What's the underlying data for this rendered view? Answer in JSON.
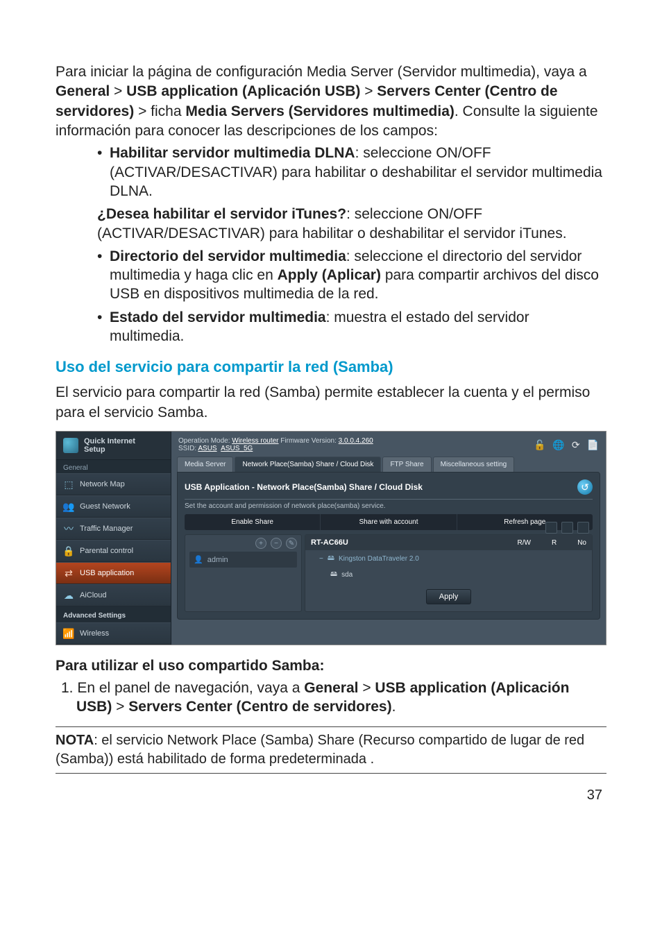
{
  "intro_pre": "Para iniciar la página de configuración Media Server (Servidor multimedia), vaya a ",
  "intro_b1": "General",
  "intro_gt1": " > ",
  "intro_b2": "USB application (Aplicación USB)",
  "intro_gt2": " > ",
  "intro_b3": "Servers Center (Centro de servidores)",
  "intro_gt3": " > ficha ",
  "intro_b4": "Media Servers (Servidores multimedia)",
  "intro_post": ". Consulte la siguiente información para conocer las descripciones de los campos:",
  "bul1_b": "Habilitar servidor multimedia DLNA",
  "bul1_t": ": seleccione ON/OFF (ACTIVAR/DESACTIVAR) para habilitar o deshabilitar el servidor multimedia DLNA.",
  "bul2_b": "¿Desea habilitar el servidor iTunes?",
  "bul2_t": ": seleccione ON/OFF (ACTIVAR/DESACTIVAR) para habilitar o deshabilitar el servidor iTunes.",
  "bul3_b": "Directorio del servidor multimedia",
  "bul3_t1": ": seleccione el directorio del servidor multimedia y haga clic en ",
  "bul3_apply": "Apply (Aplicar)",
  "bul3_t2": " para compartir archivos del disco USB en dispositivos multimedia de la red.",
  "bul4_b": "Estado del servidor multimedia",
  "bul4_t": ": muestra el estado del servidor multimedia.",
  "blue_heading": "Uso del servicio para compartir la red (Samba)",
  "samba_para": "El servicio para compartir la red (Samba) permite establecer la cuenta y el permiso para el servicio Samba.",
  "subhead": "Para utilizar el uso compartido Samba:",
  "num1_pre": "1.  En el panel de navegación, vaya a ",
  "num1_b1": "General",
  "num1_gt1": " > ",
  "num1_b2": "USB application (Aplicación USB)",
  "num1_gt2": " > ",
  "num1_b3": " Servers Center (Centro de servidores)",
  "num1_post": ".",
  "note_label": "NOTA",
  "note_text": ":  el servicio Network Place (Samba) Share (Recurso compartido de lugar de red (Samba)) está habilitado de forma predeterminada .",
  "page_number": "37",
  "router": {
    "qis_line1": "Quick Internet",
    "qis_line2": "Setup",
    "section_general": "General",
    "sb": {
      "network_map": "Network Map",
      "guest_network": "Guest Network",
      "traffic_manager": "Traffic Manager",
      "parental_control": "Parental control",
      "usb_application": "USB application",
      "aicloud": "AiCloud"
    },
    "advanced_settings": "Advanced Settings",
    "sb_wireless": "Wireless",
    "op_mode_label": "Operation Mode: ",
    "op_mode_value": "Wireless router",
    "fw_label": "   Firmware Version: ",
    "fw_value": "3.0.0.4.260",
    "ssid_label": "SSID: ",
    "ssid_v1": "ASUS",
    "ssid_v2": "ASUS_5G",
    "tabs": {
      "media_server": "Media Server",
      "samba": "Network Place(Samba) Share / Cloud Disk",
      "ftp": "FTP Share",
      "misc": "Miscellaneous setting"
    },
    "panel_title": "USB Application - Network Place(Samba) Share / Cloud Disk",
    "panel_desc": "Set the account and permission of network place(samba) service.",
    "bar": {
      "enable_share": "Enable Share",
      "share_account": "Share with account",
      "refresh": "Refresh page"
    },
    "account_name": "admin",
    "device_name": "RT-AC66U",
    "drive_label": "Kingston DataTraveler 2.0",
    "partition": "sda",
    "perm_rw": "R/W",
    "perm_r": "R",
    "perm_no": "No",
    "apply": "Apply"
  }
}
